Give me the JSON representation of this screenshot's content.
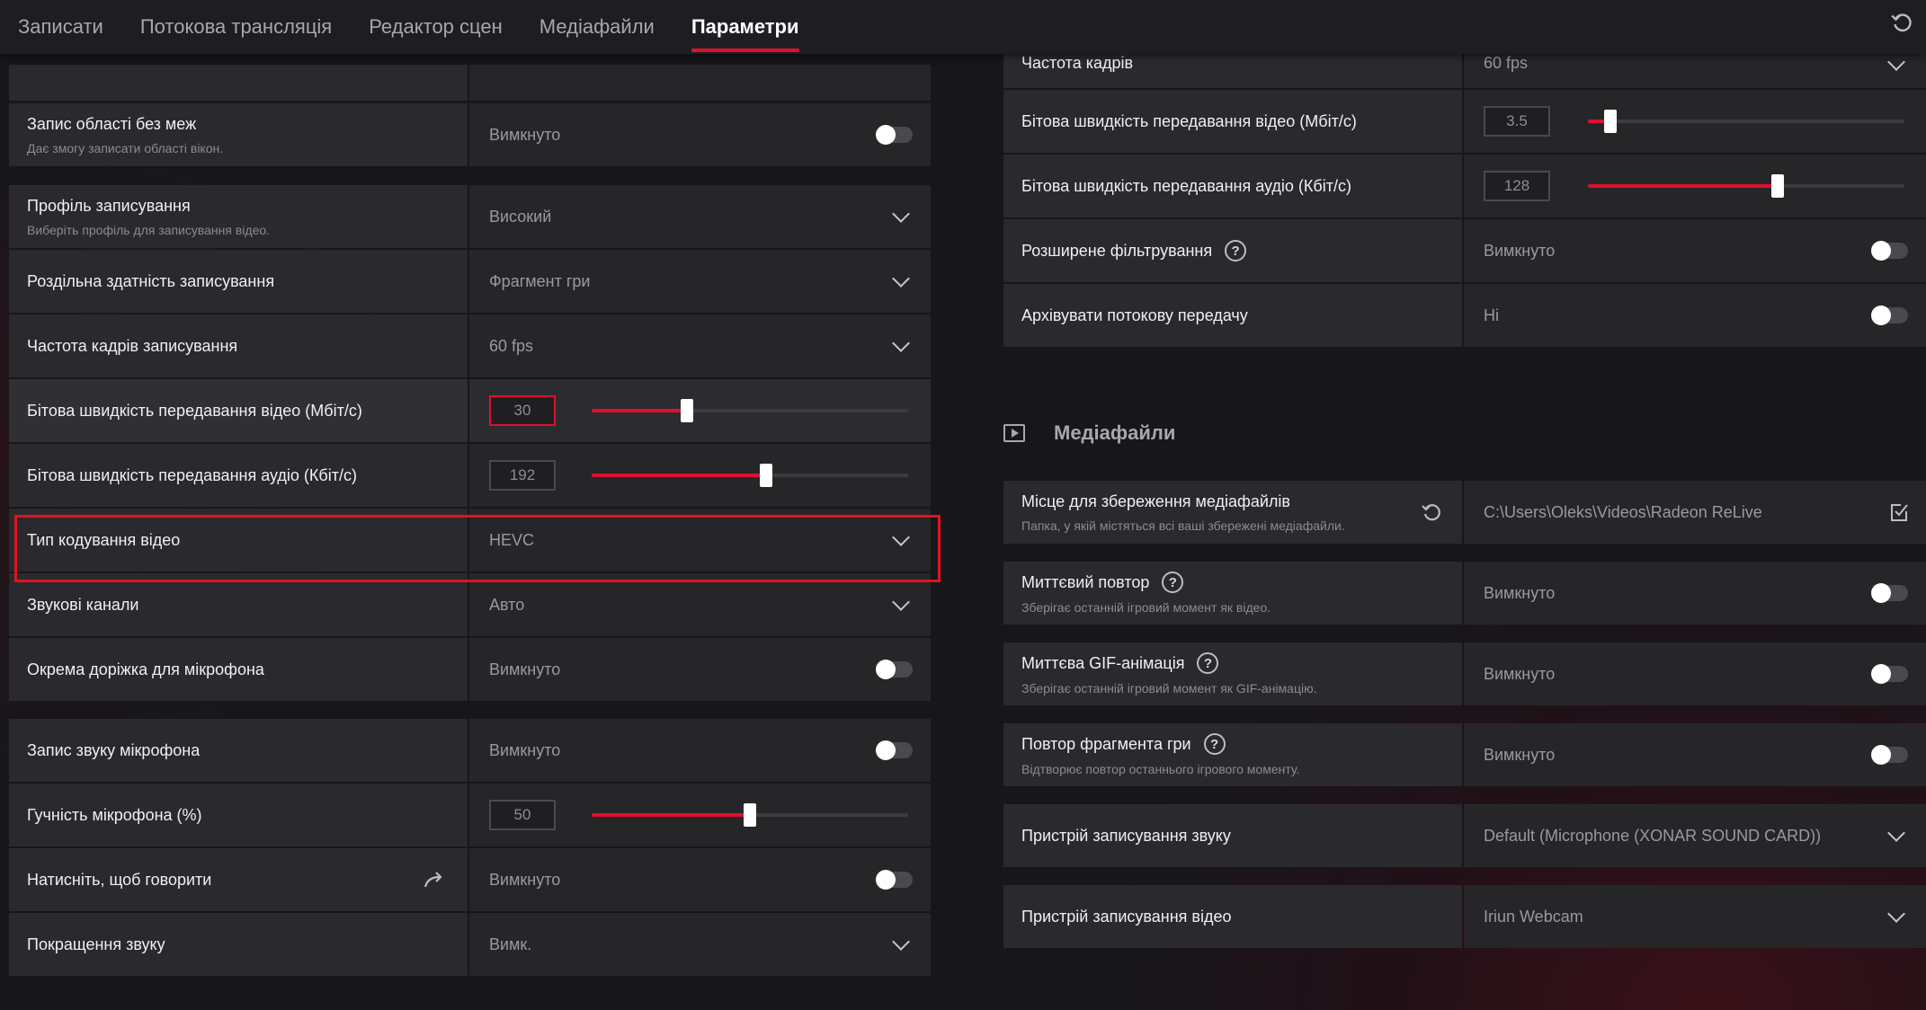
{
  "nav": {
    "tabs": [
      {
        "label": "Записати"
      },
      {
        "label": "Потокова трансляція"
      },
      {
        "label": "Редактор сцен"
      },
      {
        "label": "Медіафайли"
      },
      {
        "label": "Параметри"
      }
    ],
    "active_tab": "Параметри"
  },
  "left": {
    "region_recording": {
      "label": "Запис області без меж",
      "sub": "Дає змогу записати області вікон.",
      "value": "Вимкнуто"
    },
    "profile": {
      "label": "Профіль записування",
      "sub": "Виберіть профіль для записування відео.",
      "value": "Високий"
    },
    "resolution": {
      "label": "Роздільна здатність записування",
      "value": "Фрагмент гри"
    },
    "framerate": {
      "label": "Частота кадрів записування",
      "value": "60 fps"
    },
    "video_bitrate": {
      "label": "Бітова швидкість передавання відео (Мбіт/с)",
      "value": "30",
      "level": 0.3
    },
    "audio_bitrate": {
      "label": "Бітова швидкість передавання аудіо (Кбіт/с)",
      "value": "192",
      "level": 0.55
    },
    "encoding": {
      "label": "Тип кодування відео",
      "value": "HEVC"
    },
    "audio_channels": {
      "label": "Звукові канали",
      "value": "Авто"
    },
    "mic_track": {
      "label": "Окрема доріжка для мікрофона",
      "value": "Вимкнуто"
    },
    "mic_record": {
      "label": "Запис звуку мікрофона",
      "value": "Вимкнуто"
    },
    "mic_volume": {
      "label": "Гучність мікрофона (%)",
      "value": "50",
      "level": 0.5
    },
    "push_to_talk": {
      "label": "Натисніть, щоб говорити",
      "value": "Вимкнуто"
    },
    "sound_enhance": {
      "label": "Покращення звуку",
      "value": "Вимк."
    }
  },
  "right": {
    "framerate": {
      "label": "Частота кадрів",
      "value": "60 fps"
    },
    "video_bitrate": {
      "label": "Бітова швидкість передавання відео (Мбіт/с)",
      "value": "3.5",
      "level": 0.07
    },
    "audio_bitrate": {
      "label": "Бітова швидкість передавання аудіо (Кбіт/с)",
      "value": "128",
      "level": 0.6
    },
    "advanced_filter": {
      "label": "Розширене фільтрування",
      "value": "Вимкнуто"
    },
    "archive_stream": {
      "label": "Архівувати потокову передачу",
      "value": "Ні"
    },
    "media_section": {
      "title": "Медіафайли"
    },
    "save_location": {
      "label": "Місце для збереження медіафайлів",
      "sub": "Папка, у якій містяться всі ваші збережені медіафайли.",
      "value": "C:\\Users\\Oleks\\Videos\\Radeon ReLive"
    },
    "instant_replay": {
      "label": "Миттєвий повтор",
      "sub": "Зберігає останній ігровий момент як відео.",
      "value": "Вимкнуто"
    },
    "instant_gif": {
      "label": "Миттєва GIF-анімація",
      "sub": "Зберігає останній ігровий момент як GIF-анімацію.",
      "value": "Вимкнуто"
    },
    "game_replay": {
      "label": "Повтор фрагмента гри",
      "sub": "Відтворює повтор останнього ігрового моменту.",
      "value": "Вимкнуто"
    },
    "audio_device": {
      "label": "Пристрій записування звуку",
      "value": "Default (Microphone (XONAR SOUND CARD))"
    },
    "video_device": {
      "label": "Пристрій записування відео",
      "value": "Iriun Webcam"
    }
  },
  "colors": {
    "accent": "#e0102f",
    "highlight": "#e4121f"
  }
}
